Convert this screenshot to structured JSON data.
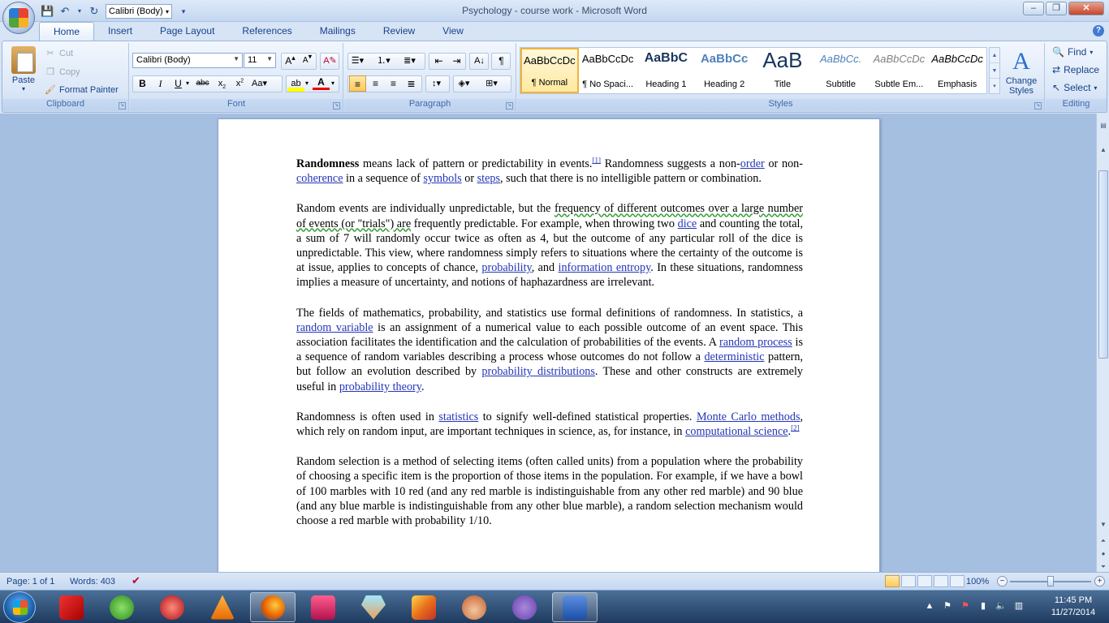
{
  "window": {
    "title": "Psychology - course work - Microsoft Word"
  },
  "qat": {
    "font_value": "Calibri (Body)"
  },
  "window_controls": {
    "minimize": "–",
    "maximize": "❐",
    "close": "✕"
  },
  "tabs": [
    "Home",
    "Insert",
    "Page Layout",
    "References",
    "Mailings",
    "Review",
    "View"
  ],
  "ribbon": {
    "clipboard": {
      "label": "Clipboard",
      "paste": "Paste",
      "cut": "Cut",
      "copy": "Copy",
      "format_painter": "Format Painter"
    },
    "font": {
      "label": "Font",
      "font_name": "Calibri (Body)",
      "font_size": "11"
    },
    "paragraph": {
      "label": "Paragraph"
    },
    "styles": {
      "label": "Styles",
      "items": [
        {
          "preview": "AaBbCcDc",
          "name": "¶ Normal"
        },
        {
          "preview": "AaBbCcDc",
          "name": "¶ No Spaci..."
        },
        {
          "preview": "AaBbC",
          "name": "Heading 1"
        },
        {
          "preview": "AaBbCc",
          "name": "Heading 2"
        },
        {
          "preview": "AaB",
          "name": "Title"
        },
        {
          "preview": "AaBbCc.",
          "name": "Subtitle"
        },
        {
          "preview": "AaBbCcDc",
          "name": "Subtle Em..."
        },
        {
          "preview": "AaBbCcDc",
          "name": "Emphasis"
        }
      ],
      "change_styles": "Change Styles"
    },
    "editing": {
      "label": "Editing",
      "find": "Find",
      "replace": "Replace",
      "select": "Select"
    }
  },
  "document": {
    "p1": {
      "b1": "Randomness",
      "t1": " means lack of pattern or predictability in events.",
      "s1": "[1]",
      "t2": " Randomness suggests a non-",
      "l1": "order",
      "t3": " or non-",
      "l2": "coherence",
      "t4": " in a sequence of ",
      "l3": "symbols",
      "t5": " or ",
      "l4": "steps",
      "t6": ", such that there is no intelligible pattern or combination."
    },
    "p2": {
      "t1": "Random events are individually unpredictable, but the ",
      "sq1": "frequency of different outcomes over a large number of events (or \"trials\") are",
      "t2": " frequently predictable. For example, when throwing two ",
      "l1": "dice",
      "t3": " and counting the total, a sum of 7 will randomly occur twice as often as 4, but the outcome of any particular roll of the dice is unpredictable. This view, where randomness simply refers to situations where the certainty of the outcome is at issue, applies to concepts of chance, ",
      "l2": "probability",
      "t4": ", and ",
      "l3": "information entropy",
      "t5": ". In these situations, randomness implies a measure of uncertainty, and notions of haphazardness are irrelevant."
    },
    "p3": {
      "t1": "The fields of mathematics, probability, and statistics use formal definitions of randomness. In statistics, a ",
      "l1": "random variable",
      "t2": " is an assignment of a numerical value to each possible outcome of an event space. This association facilitates the identification and the calculation of probabilities of the events. A ",
      "l2": "random process",
      "t3": " is a sequence of random variables describing a process whose outcomes do not follow a ",
      "l3": "deterministic",
      "t4": " pattern, but follow an evolution described by ",
      "l4": "probability distributions",
      "t5": ". These and other constructs are extremely useful in ",
      "l5": "probability theory",
      "t6": "."
    },
    "p4": {
      "t1": "Randomness is often used in ",
      "l1": "statistics",
      "t2": " to signify well-defined statistical properties. ",
      "l2": "Monte Carlo methods",
      "t3": ", which rely on random input, are important techniques in science, as, for instance, in ",
      "l3": "computational science",
      "t4": ".",
      "s1": "[2]"
    },
    "p5": {
      "t1": "Random selection is a method of selecting items (often called units) from a population where the probability of choosing a specific item is the proportion of those items in the population. For example, if we have a bowl of 100 marbles with 10 red (and any red marble is indistinguishable from any other red marble) and 90 blue (and any blue marble is indistinguishable from any other blue marble), a random selection mechanism would choose a red marble with probability 1/10."
    }
  },
  "status": {
    "page": "Page: 1 of 1",
    "words": "Words: 403",
    "zoom": "100%"
  },
  "taskbar": {
    "time": "11:45 PM",
    "date": "11/27/2014"
  },
  "colors": {
    "link": "#2436b8",
    "ribbon_bg": "#dbe7f7",
    "taskbar": "#1f3a5f"
  }
}
